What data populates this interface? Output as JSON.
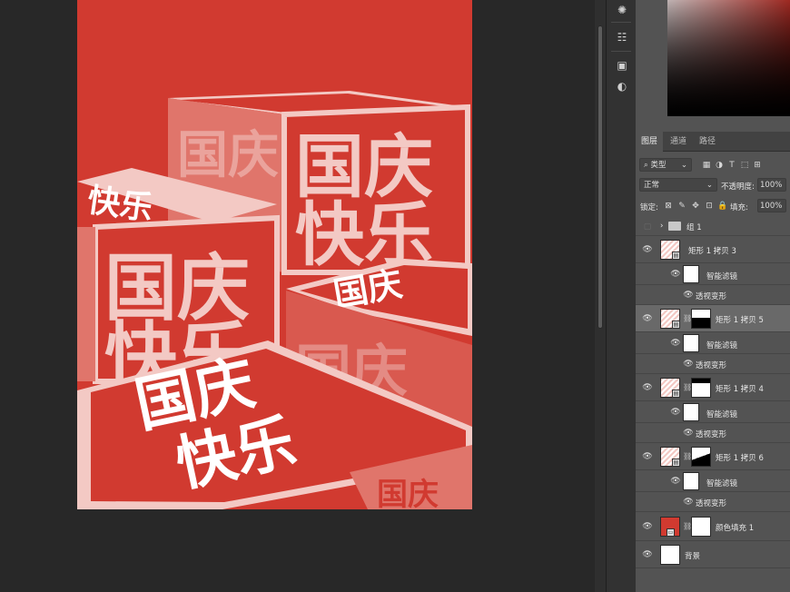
{
  "poster": {
    "tile_main": "国庆",
    "tile_sub": "快乐",
    "colors": {
      "background": "#d13a30",
      "face_light": "#f3c9c4",
      "text_white": "#ffffff"
    }
  },
  "tabs": [
    {
      "label": "图层",
      "active": true
    },
    {
      "label": "通道",
      "active": false
    },
    {
      "label": "路径",
      "active": false
    }
  ],
  "filter": {
    "kind_label": "类型"
  },
  "blend": {
    "mode": "正常",
    "opacity_label": "不透明度:",
    "opacity_value": "100%"
  },
  "lock": {
    "label": "锁定:",
    "fill_label": "填充:",
    "fill_value": "100%"
  },
  "layers": [
    {
      "name": "组 1",
      "type": "group",
      "visible": false
    },
    {
      "name": "矩形 1 拷贝 3",
      "type": "smart",
      "visible": true
    },
    {
      "name": "智能滤镜",
      "type": "filter",
      "visible": true
    },
    {
      "name": "透视变形",
      "type": "effect",
      "visible": true
    },
    {
      "name": "矩形 1 拷贝 5",
      "type": "smart-mask",
      "visible": true,
      "selected": true
    },
    {
      "name": "智能滤镜",
      "type": "filter",
      "visible": true
    },
    {
      "name": "透视变形",
      "type": "effect",
      "visible": true
    },
    {
      "name": "矩形 1 拷贝 4",
      "type": "smart-mask",
      "visible": true
    },
    {
      "name": "智能滤镜",
      "type": "filter",
      "visible": true
    },
    {
      "name": "透视变形",
      "type": "effect",
      "visible": true
    },
    {
      "name": "矩形 1 拷贝 6",
      "type": "smart-mask",
      "visible": true
    },
    {
      "name": "智能滤镜",
      "type": "filter",
      "visible": true
    },
    {
      "name": "透视变形",
      "type": "effect",
      "visible": true
    },
    {
      "name": "颜色填充 1",
      "type": "fill",
      "visible": true
    },
    {
      "name": "背景",
      "type": "background",
      "visible": true
    }
  ]
}
